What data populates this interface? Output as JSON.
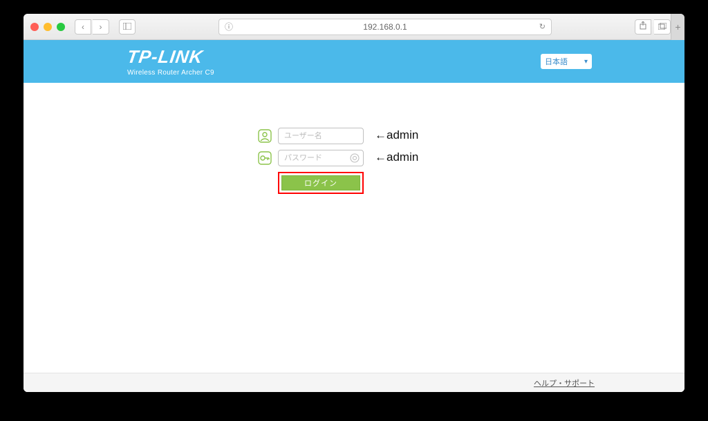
{
  "browser": {
    "url": "192.168.0.1"
  },
  "header": {
    "brand_name": "TP-LINK",
    "brand_subtitle": "Wireless Router Archer C9",
    "language_label": "日本語"
  },
  "login": {
    "username_placeholder": "ユーザー名",
    "password_placeholder": "パスワード",
    "button_label": "ログイン",
    "username_value": "",
    "password_value": ""
  },
  "annotations": {
    "username_hint": "←admin",
    "password_hint": "←admin"
  },
  "footer": {
    "support_link": "ヘルプ・サポート"
  },
  "colors": {
    "header_bg": "#4bb9ea",
    "button_bg": "#8bc34a",
    "highlight_border": "#ff0000"
  }
}
